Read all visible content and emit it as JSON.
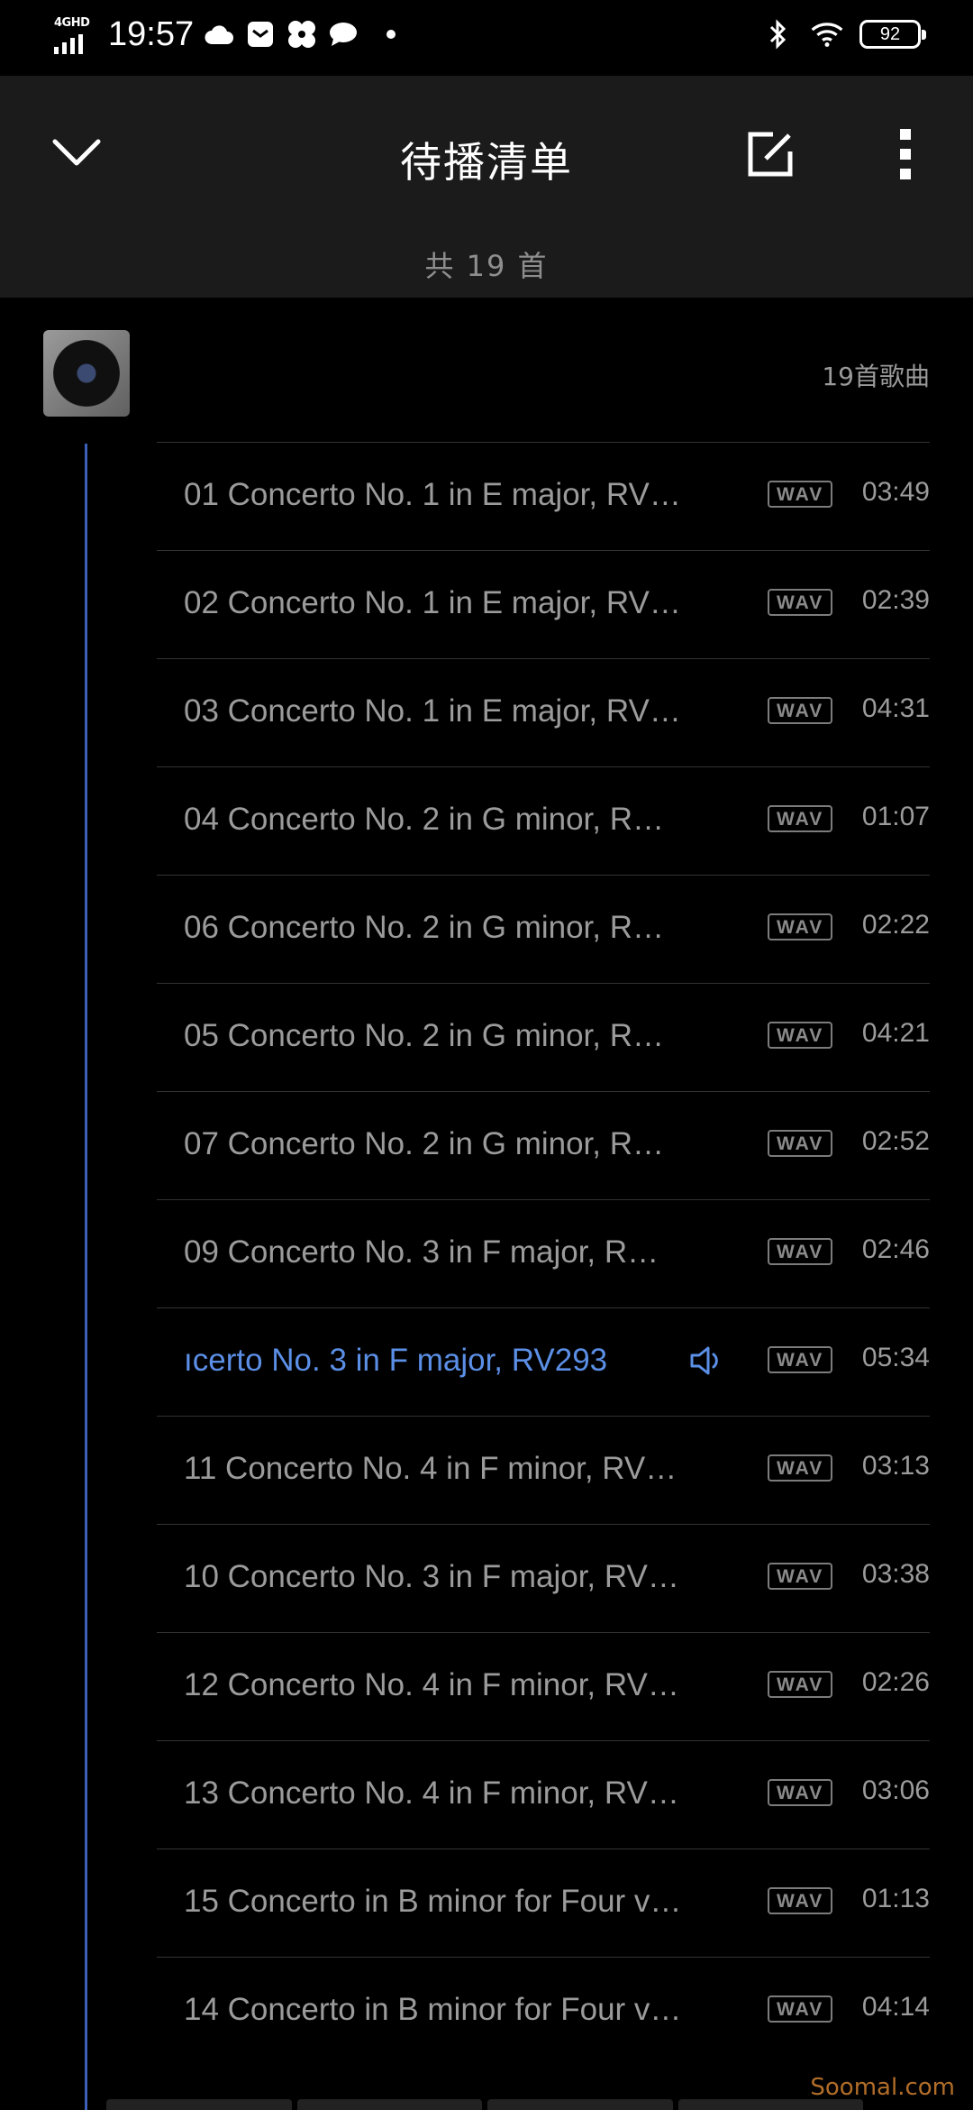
{
  "status_bar": {
    "network": "4GHD",
    "time": "19:57",
    "battery": "92"
  },
  "header": {
    "title": "待播清单",
    "count": "共 19 首"
  },
  "group": {
    "count_label": "19首歌曲"
  },
  "tracks": [
    {
      "title": "01 Concerto No. 1 in E major, RV…",
      "format": "WAV",
      "duration": "03:49"
    },
    {
      "title": "02 Concerto No. 1 in E major, RV…",
      "format": "WAV",
      "duration": "02:39"
    },
    {
      "title": "03 Concerto No. 1 in E major, RV…",
      "format": "WAV",
      "duration": "04:31"
    },
    {
      "title": "04 Concerto No. 2 in G minor, R…",
      "format": "WAV",
      "duration": "01:07"
    },
    {
      "title": "06 Concerto No. 2 in G minor, R…",
      "format": "WAV",
      "duration": "02:22"
    },
    {
      "title": "05 Concerto No. 2 in G minor, R…",
      "format": "WAV",
      "duration": "04:21"
    },
    {
      "title": "07 Concerto No. 2 in G minor, R…",
      "format": "WAV",
      "duration": "02:52"
    },
    {
      "title": "09 Concerto No. 3 in F major, R…",
      "format": "WAV",
      "duration": "02:46"
    },
    {
      "title": "ıcerto No. 3 in F major, RV293",
      "format": "WAV",
      "duration": "05:34"
    },
    {
      "title": "11 Concerto No. 4 in F minor, RV…",
      "format": "WAV",
      "duration": "03:13"
    },
    {
      "title": "10 Concerto No. 3 in F major, RV…",
      "format": "WAV",
      "duration": "03:38"
    },
    {
      "title": "12 Concerto No. 4 in F minor, RV…",
      "format": "WAV",
      "duration": "02:26"
    },
    {
      "title": "13 Concerto No. 4 in F minor, RV…",
      "format": "WAV",
      "duration": "03:06"
    },
    {
      "title": "15 Concerto in B minor for Four v…",
      "format": "WAV",
      "duration": "01:13"
    },
    {
      "title": "14 Concerto in B minor for Four v…",
      "format": "WAV",
      "duration": "04:14"
    }
  ],
  "now_playing_index": 8,
  "colors": {
    "background": "#000000",
    "header_bg": "#1b1b1b",
    "accent": "#5b8fe6",
    "text_muted": "#9b9b9b"
  },
  "watermark": "Soomal.com"
}
